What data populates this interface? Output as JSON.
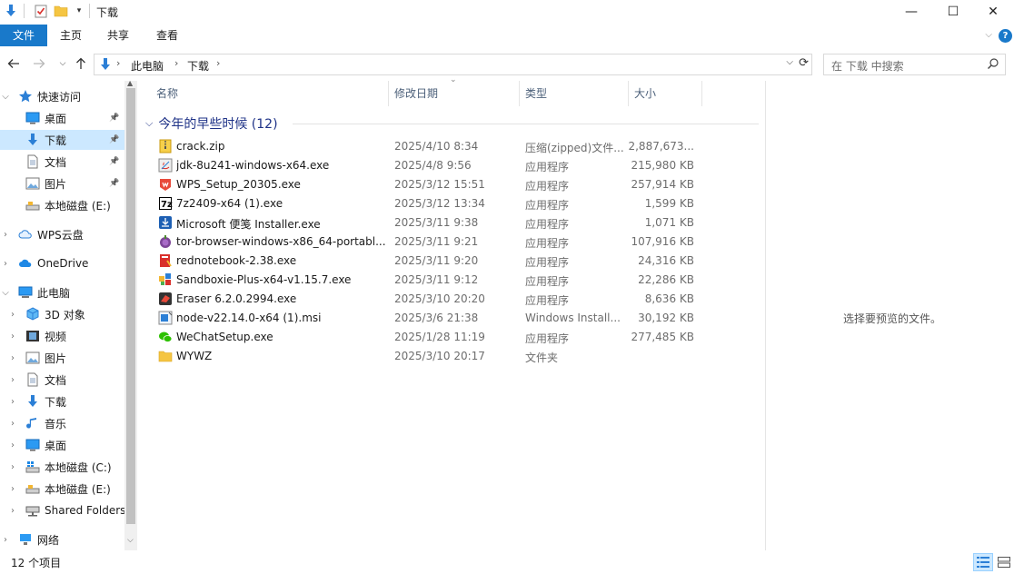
{
  "window": {
    "title": "下载",
    "minimize": "—",
    "maximize": "☐",
    "close": "✕"
  },
  "ribbon": {
    "tabs": [
      "文件",
      "主页",
      "共享",
      "查看"
    ],
    "help": "?"
  },
  "address": {
    "crumbs": [
      "此电脑",
      "下载"
    ],
    "search_placeholder": "在 下载 中搜索"
  },
  "sidebar": {
    "items": [
      {
        "label": "快速访问",
        "icon": "star-icon"
      },
      {
        "label": "桌面",
        "icon": "desktop-icon",
        "pinned": true
      },
      {
        "label": "下载",
        "icon": "download-icon",
        "pinned": true,
        "selected": true
      },
      {
        "label": "文档",
        "icon": "document-icon",
        "pinned": true
      },
      {
        "label": "图片",
        "icon": "picture-icon",
        "pinned": true
      },
      {
        "label": "本地磁盘 (E:)",
        "icon": "drive-icon"
      },
      {
        "label": "WPS云盘",
        "icon": "cloud-icon"
      },
      {
        "label": "OneDrive",
        "icon": "onedrive-icon"
      },
      {
        "label": "此电脑",
        "icon": "computer-icon"
      },
      {
        "label": "3D 对象",
        "icon": "cube-icon"
      },
      {
        "label": "视频",
        "icon": "video-icon"
      },
      {
        "label": "图片",
        "icon": "picture-icon"
      },
      {
        "label": "文档",
        "icon": "document-icon"
      },
      {
        "label": "下载",
        "icon": "download-icon"
      },
      {
        "label": "音乐",
        "icon": "music-icon"
      },
      {
        "label": "桌面",
        "icon": "desktop-icon"
      },
      {
        "label": "本地磁盘 (C:)",
        "icon": "windows-drive-icon"
      },
      {
        "label": "本地磁盘 (E:)",
        "icon": "drive-icon"
      },
      {
        "label": "Shared Folders",
        "icon": "network-drive-icon"
      },
      {
        "label": "网络",
        "icon": "network-icon"
      }
    ]
  },
  "columns": {
    "name": "名称",
    "date": "修改日期",
    "type": "类型",
    "size": "大小"
  },
  "group": {
    "label": "今年的早些时候 (12)"
  },
  "files": [
    {
      "name": "crack.zip",
      "date": "2025/4/10 8:34",
      "type": "压缩(zipped)文件...",
      "size": "2,887,673...",
      "icon": "zip-icon"
    },
    {
      "name": "jdk-8u241-windows-x64.exe",
      "date": "2025/4/8 9:56",
      "type": "应用程序",
      "size": "215,980 KB",
      "icon": "java-installer-icon"
    },
    {
      "name": "WPS_Setup_20305.exe",
      "date": "2025/3/12 15:51",
      "type": "应用程序",
      "size": "257,914 KB",
      "icon": "wps-icon"
    },
    {
      "name": "7z2409-x64 (1).exe",
      "date": "2025/3/12 13:34",
      "type": "应用程序",
      "size": "1,599 KB",
      "icon": "7zip-icon"
    },
    {
      "name": "Microsoft 便笺 Installer.exe",
      "date": "2025/3/11 9:38",
      "type": "应用程序",
      "size": "1,071 KB",
      "icon": "installer-icon"
    },
    {
      "name": "tor-browser-windows-x86_64-portabl...",
      "date": "2025/3/11 9:21",
      "type": "应用程序",
      "size": "107,916 KB",
      "icon": "tor-icon"
    },
    {
      "name": "rednotebook-2.38.exe",
      "date": "2025/3/11 9:20",
      "type": "应用程序",
      "size": "24,316 KB",
      "icon": "rednotebook-icon"
    },
    {
      "name": "Sandboxie-Plus-x64-v1.15.7.exe",
      "date": "2025/3/11 9:12",
      "type": "应用程序",
      "size": "22,286 KB",
      "icon": "sandboxie-icon"
    },
    {
      "name": "Eraser 6.2.0.2994.exe",
      "date": "2025/3/10 20:20",
      "type": "应用程序",
      "size": "8,636 KB",
      "icon": "eraser-icon"
    },
    {
      "name": "node-v22.14.0-x64 (1).msi",
      "date": "2025/3/6 21:38",
      "type": "Windows Install...",
      "size": "30,192 KB",
      "icon": "msi-icon"
    },
    {
      "name": "WeChatSetup.exe",
      "date": "2025/1/28 11:19",
      "type": "应用程序",
      "size": "277,485 KB",
      "icon": "wechat-icon"
    },
    {
      "name": "WYWZ",
      "date": "2025/3/10 20:17",
      "type": "文件夹",
      "size": "",
      "icon": "folder-icon"
    }
  ],
  "preview": {
    "empty_text": "选择要预览的文件。"
  },
  "status": {
    "text": "12 个项目"
  }
}
